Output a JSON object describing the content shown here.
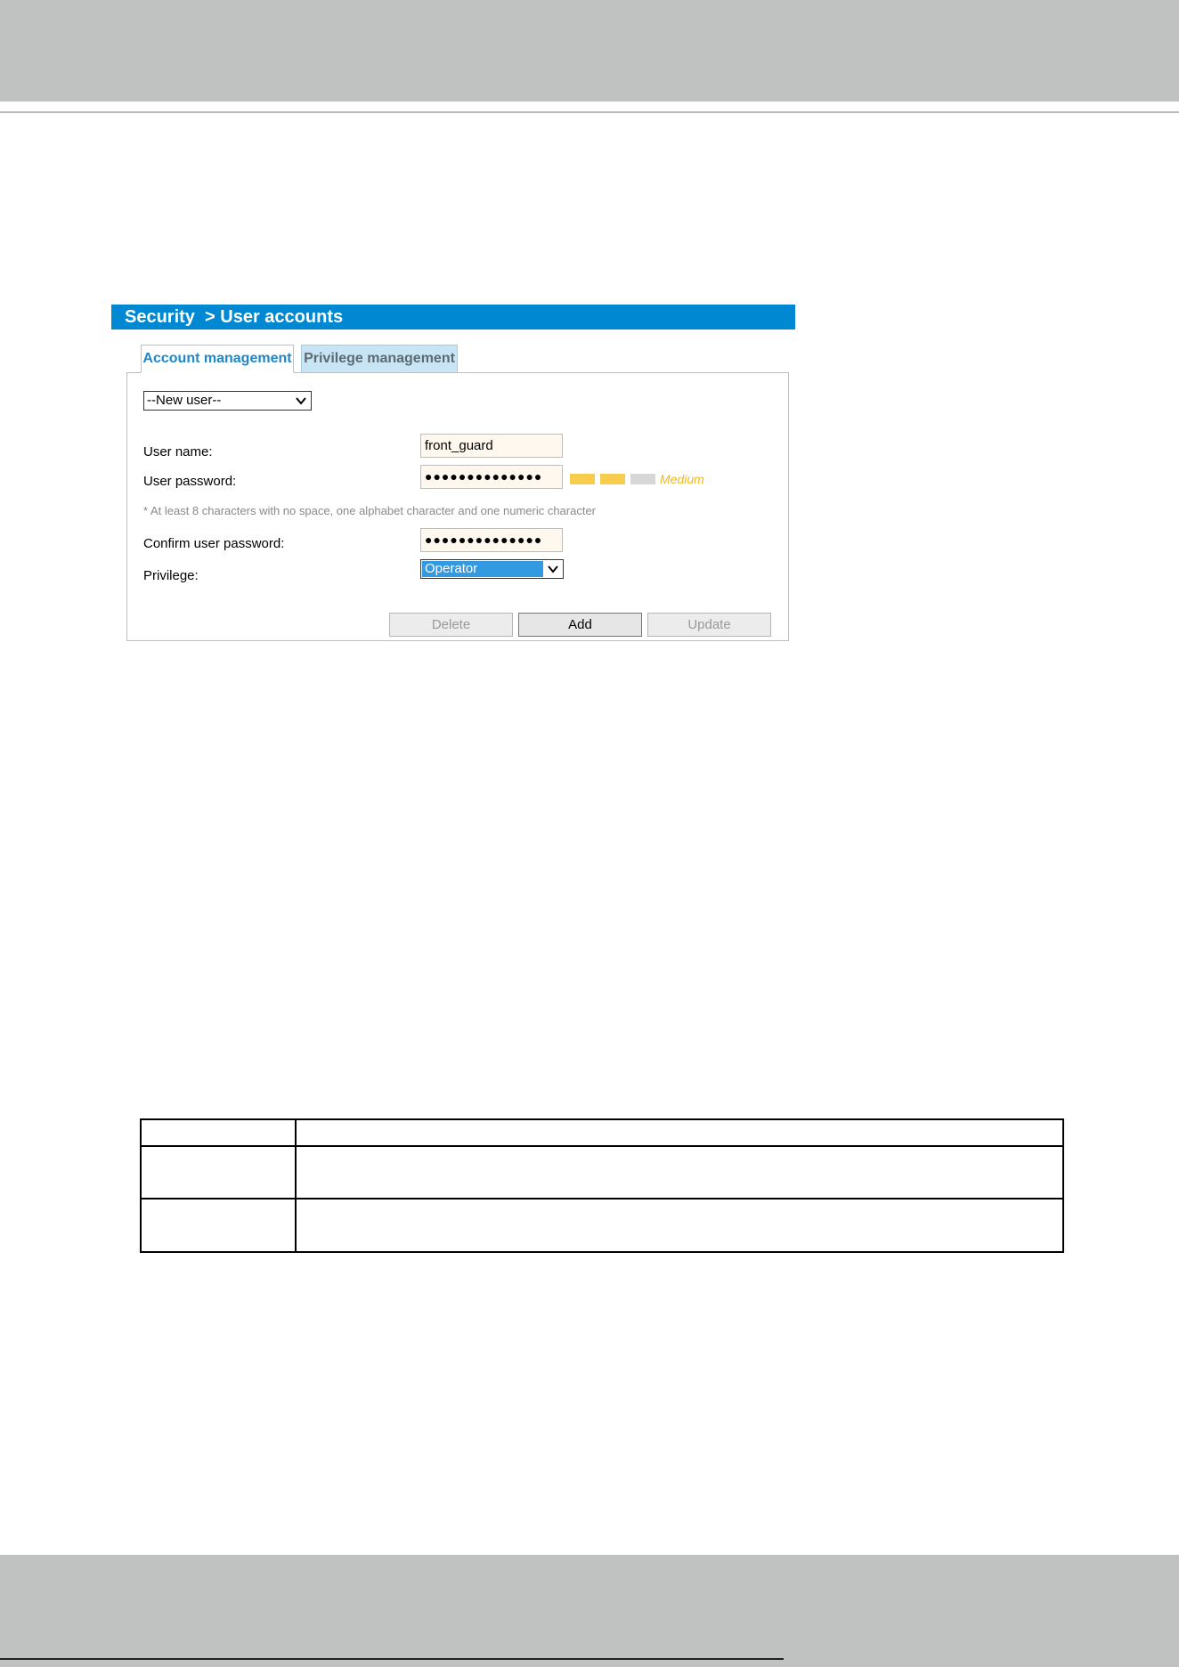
{
  "page": {
    "title": "Security  > User accounts"
  },
  "tabs": [
    {
      "label": "Account management",
      "active": true
    },
    {
      "label": "Privilege management",
      "active": false
    }
  ],
  "account_form": {
    "user_select": {
      "value": "--New user--"
    },
    "user_name": {
      "label": "User name:",
      "value": "front_guard"
    },
    "user_password": {
      "label": "User password:",
      "value": "●●●●●●●●●●●●●●"
    },
    "strength": {
      "label": "Medium",
      "level": 2,
      "max": 3,
      "colors": {
        "on": "#f8cc4d",
        "off": "#d7d7d7",
        "text": "#f0b91a"
      }
    },
    "hint": "* At least 8 characters with no space, one alphabet character and one numeric character",
    "confirm_password": {
      "label": "Confirm user password:",
      "value": "●●●●●●●●●●●●●●"
    },
    "privilege": {
      "label": "Privilege:",
      "value": "Operator"
    },
    "buttons": {
      "delete": "Delete",
      "add": "Add",
      "update": "Update"
    }
  },
  "colors": {
    "title_bar": "#0088d2",
    "active_tab_text": "#1f87c8",
    "inactive_tab_bg": "#c7e5f5",
    "field_bg": "#fff8ee",
    "header_band": "#c0c1c1"
  },
  "icons": {
    "dropdown": "chevron-down-icon"
  },
  "table": {
    "rows": [
      [
        "",
        ""
      ],
      [
        "",
        ""
      ],
      [
        "",
        ""
      ]
    ]
  }
}
